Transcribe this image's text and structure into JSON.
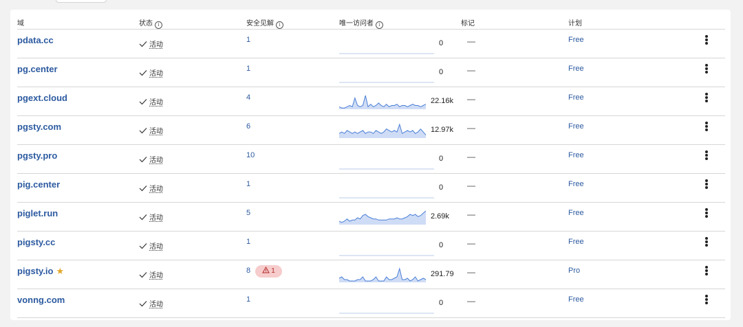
{
  "header": {
    "domain": "域",
    "status": "状态",
    "insights": "安全见解",
    "visitors": "唯一访问者",
    "marker": "标记",
    "plan": "计划",
    "info_glyph": "i"
  },
  "rows": [
    {
      "domain": "pdata.cc",
      "status": "活动",
      "insights": "1",
      "visitors": "0",
      "marker": "—",
      "plan": "Free",
      "spark": []
    },
    {
      "domain": "pg.center",
      "status": "活动",
      "insights": "1",
      "visitors": "0",
      "marker": "—",
      "plan": "Free",
      "spark": []
    },
    {
      "domain": "pgext.cloud",
      "status": "活动",
      "insights": "4",
      "visitors": "22.16k",
      "marker": "—",
      "plan": "Free",
      "spark": [
        2,
        1,
        1,
        2,
        3,
        2,
        9,
        3,
        2,
        3,
        11,
        2,
        4,
        2,
        3,
        5,
        3,
        2,
        4,
        2,
        3,
        3,
        4,
        2,
        3,
        3,
        2,
        3,
        4,
        3,
        3,
        2,
        3,
        4
      ]
    },
    {
      "domain": "pgsty.com",
      "status": "活动",
      "insights": "6",
      "visitors": "12.97k",
      "marker": "—",
      "plan": "Free",
      "spark": [
        3,
        4,
        3,
        5,
        4,
        3,
        4,
        3,
        4,
        5,
        3,
        4,
        4,
        3,
        5,
        4,
        3,
        4,
        6,
        5,
        4,
        5,
        4,
        9,
        3,
        4,
        5,
        4,
        5,
        3,
        4,
        6,
        4,
        2
      ]
    },
    {
      "domain": "pgsty.pro",
      "status": "活动",
      "insights": "10",
      "visitors": "0",
      "marker": "—",
      "plan": "Free",
      "spark": []
    },
    {
      "domain": "pig.center",
      "status": "活动",
      "insights": "1",
      "visitors": "0",
      "marker": "—",
      "plan": "Free",
      "spark": []
    },
    {
      "domain": "piglet.run",
      "status": "活动",
      "insights": "5",
      "visitors": "2.69k",
      "marker": "—",
      "plan": "Free",
      "spark": [
        3,
        2,
        3,
        5,
        3,
        4,
        4,
        6,
        5,
        8,
        9,
        7,
        6,
        5,
        5,
        4,
        4,
        4,
        4,
        5,
        5,
        5,
        6,
        5,
        5,
        6,
        7,
        9,
        8,
        9,
        7,
        8,
        10,
        12
      ]
    },
    {
      "domain": "pigsty.cc",
      "status": "活动",
      "insights": "1",
      "visitors": "0",
      "marker": "—",
      "plan": "Free",
      "spark": []
    },
    {
      "domain": "pigsty.io",
      "starred": true,
      "status": "活动",
      "insights": "8",
      "alert": "1",
      "visitors": "291.79",
      "marker": "—",
      "plan": "Pro",
      "spark": [
        3,
        4,
        2,
        2,
        1,
        1,
        1,
        2,
        2,
        4,
        1,
        1,
        1,
        2,
        4,
        1,
        1,
        1,
        4,
        2,
        2,
        3,
        4,
        10,
        2,
        2,
        3,
        1,
        2,
        4,
        1,
        2,
        3,
        2
      ]
    },
    {
      "domain": "vonng.com",
      "status": "活动",
      "insights": "1",
      "visitors": "0",
      "marker": "—",
      "plan": "Free",
      "spark": []
    }
  ],
  "colors": {
    "link": "#2c5aa0",
    "spark_line": "#4a7fd6",
    "spark_fill": "#cfdcf5",
    "alert_bg": "#f6cccc",
    "alert_text": "#b42828",
    "star": "#e0a72a"
  },
  "icons": {
    "status": "check-icon",
    "alert": "warning-triangle-icon",
    "more": "kebab-menu-icon",
    "star": "star-icon"
  }
}
